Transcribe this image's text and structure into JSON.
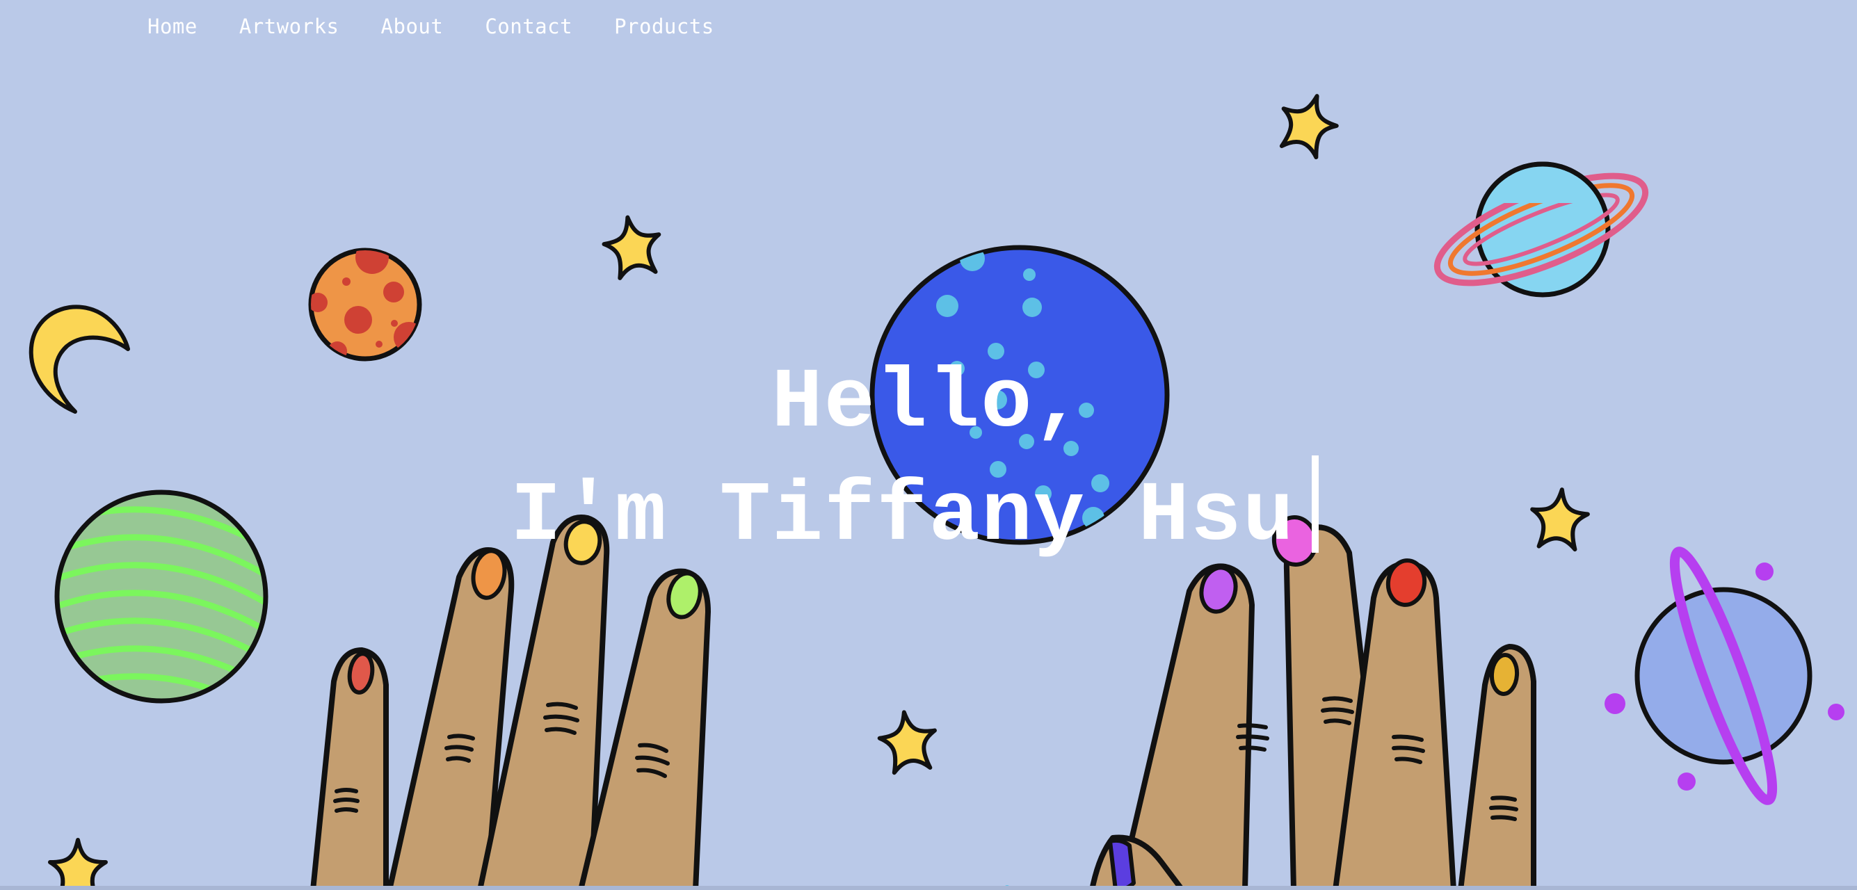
{
  "nav": {
    "items": [
      {
        "label": "Home"
      },
      {
        "label": "Artworks"
      },
      {
        "label": "About"
      },
      {
        "label": "Contact"
      },
      {
        "label": "Products"
      }
    ]
  },
  "hero": {
    "greeting": "Hello,",
    "intro": "I'm Tiffany Hsu"
  },
  "colors": {
    "background": "#bac9e8",
    "text": "#ffffff",
    "star": "#fbd655",
    "blue_planet": "#3a59e8",
    "skin": "#c49e70"
  },
  "icons": [
    "moon-icon",
    "orange-planet-icon",
    "star-icon",
    "blue-planet-icon",
    "ringed-planet-icon",
    "green-striped-planet-icon",
    "purple-ringed-planet-icon",
    "left-hand-illustration",
    "right-hand-illustration"
  ]
}
